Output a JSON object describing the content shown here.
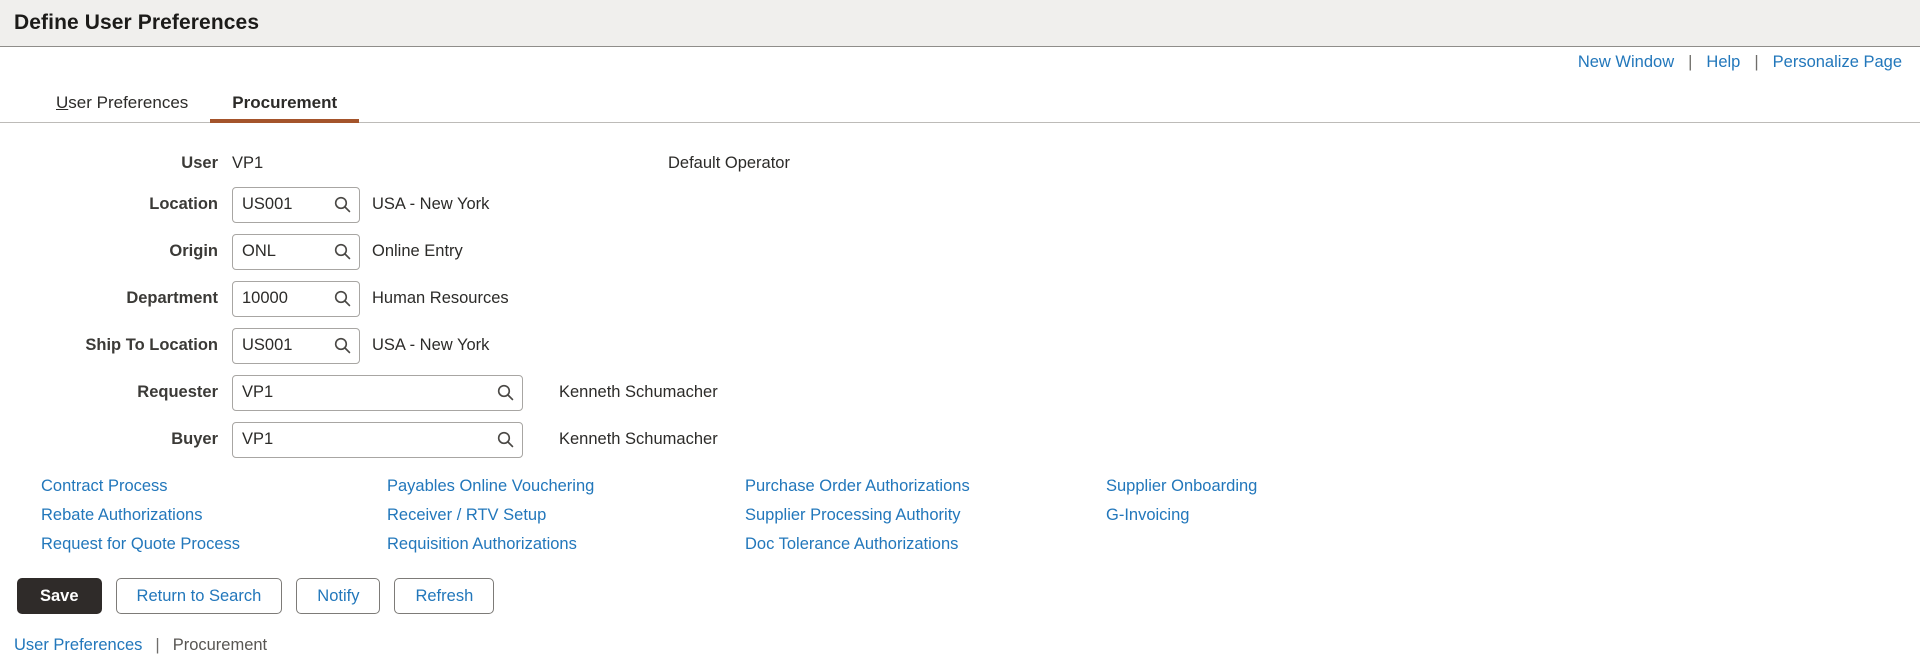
{
  "header": {
    "title": "Define User Preferences"
  },
  "utility_links": [
    {
      "label": "New Window",
      "name": "new-window-link"
    },
    {
      "label": "Help",
      "name": "help-link"
    },
    {
      "label": "Personalize Page",
      "name": "personalize-page-link"
    }
  ],
  "utility_separator": "|",
  "tabs": [
    {
      "label": "User Preferences",
      "accesskey_char": "U",
      "rest": "ser Preferences",
      "active": false
    },
    {
      "label": "Procurement",
      "active": true
    }
  ],
  "form": {
    "user": {
      "label": "User",
      "value": "VP1"
    },
    "default_operator_label": "Default Operator",
    "fields": [
      {
        "label": "Location",
        "value": "US001",
        "description": "USA - New York",
        "size": "sm",
        "name_prefix": "location"
      },
      {
        "label": "Origin",
        "value": "ONL",
        "description": "Online Entry",
        "size": "sm",
        "name_prefix": "origin"
      },
      {
        "label": "Department",
        "value": "10000",
        "description": "Human Resources",
        "size": "sm",
        "name_prefix": "department"
      },
      {
        "label": "Ship To Location",
        "value": "US001",
        "description": "USA - New York",
        "size": "sm",
        "name_prefix": "ship-to-location"
      },
      {
        "label": "Requester",
        "value": "VP1",
        "description": "Kenneth Schumacher",
        "size": "lg",
        "name_prefix": "requester"
      },
      {
        "label": "Buyer",
        "value": "VP1",
        "description": "Kenneth Schumacher",
        "size": "lg",
        "name_prefix": "buyer"
      }
    ]
  },
  "link_columns": [
    [
      {
        "label": "Contract Process",
        "name": "contract-process-link"
      },
      {
        "label": "Rebate Authorizations",
        "name": "rebate-authorizations-link"
      },
      {
        "label": "Request for Quote Process",
        "name": "request-for-quote-process-link"
      }
    ],
    [
      {
        "label": "Payables Online Vouchering",
        "name": "payables-online-vouchering-link"
      },
      {
        "label": "Receiver / RTV Setup",
        "name": "receiver-rtv-setup-link"
      },
      {
        "label": "Requisition Authorizations",
        "name": "requisition-authorizations-link"
      }
    ],
    [
      {
        "label": "Purchase Order Authorizations",
        "name": "purchase-order-authorizations-link"
      },
      {
        "label": "Supplier Processing Authority",
        "name": "supplier-processing-authority-link"
      },
      {
        "label": "Doc Tolerance Authorizations",
        "name": "doc-tolerance-authorizations-link"
      }
    ],
    [
      {
        "label": "Supplier Onboarding",
        "name": "supplier-onboarding-link"
      },
      {
        "label": "G-Invoicing",
        "name": "g-invoicing-link"
      }
    ]
  ],
  "buttons": [
    {
      "label": "Save",
      "style": "primary",
      "name": "save-button"
    },
    {
      "label": "Return to Search",
      "style": "secondary",
      "name": "return-to-search-button"
    },
    {
      "label": "Notify",
      "style": "secondary",
      "name": "notify-button"
    },
    {
      "label": "Refresh",
      "style": "secondary",
      "name": "refresh-button"
    }
  ],
  "footer": {
    "link_label": "User Preferences",
    "separator": "|",
    "current_label": "Procurement"
  },
  "icons": {
    "lookup": "search-icon"
  },
  "colors": {
    "accent_tab_underline": "#a4542b",
    "link_blue": "#2277bb",
    "header_bg": "#f0efed",
    "primary_button_bg": "#2f2b29"
  }
}
